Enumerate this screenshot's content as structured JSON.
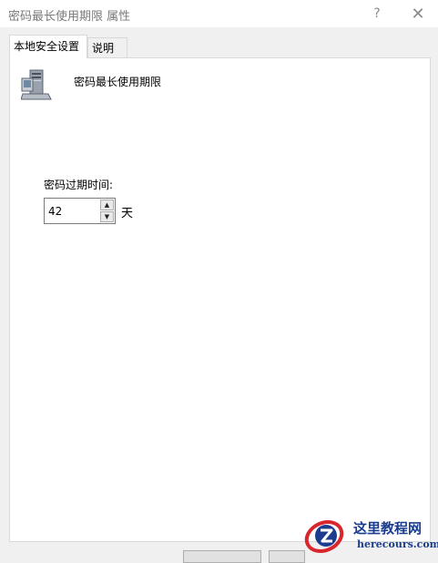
{
  "window": {
    "title": "密码最长使用期限 属性",
    "help_label": "?",
    "close_label": "✕"
  },
  "tabs": [
    {
      "label": "本地安全设置",
      "active": true
    },
    {
      "label": "说明",
      "active": false
    }
  ],
  "policy": {
    "name": "密码最长使用期限",
    "icon": "server-computer-icon"
  },
  "field": {
    "label": "密码过期时间:",
    "value": "42",
    "unit": "天",
    "up_symbol": "▲",
    "down_symbol": "▼"
  },
  "watermark": {
    "title": "这里教程网",
    "url": "herecours.com",
    "accent_color": "#d9262c",
    "text_color": "#1c3d8f"
  }
}
